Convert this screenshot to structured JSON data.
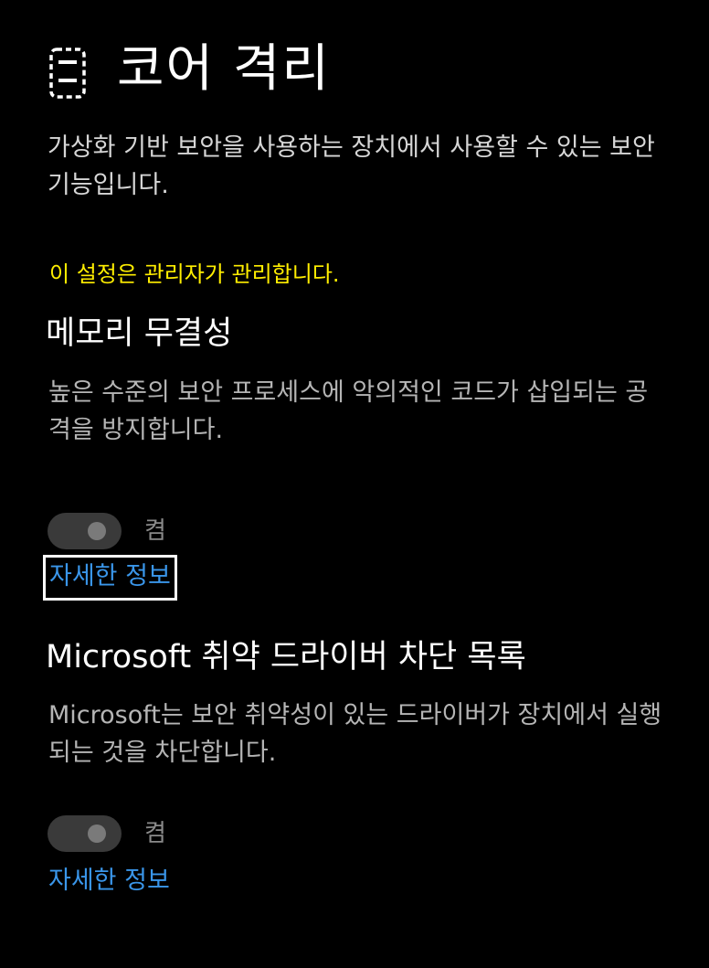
{
  "header": {
    "icon": "core-isolation-chip-icon",
    "title": "코어 격리",
    "description": "가상화 기반 보안을 사용하는 장치에서 사용할 수 있는 보안 기능입니다."
  },
  "managed_notice": "이 설정은 관리자가 관리합니다.",
  "memory_integrity": {
    "title": "메모리 무결성",
    "description": "높은 수준의 보안 프로세스에 악의적인 코드가 삽입되는 공격을 방지합니다.",
    "toggle_state": "켬",
    "toggle_on": true,
    "toggle_enabled": false,
    "learn_more": "자세한 정보"
  },
  "driver_blocklist": {
    "title": "Microsoft 취약 드라이버 차단 목록",
    "description": "Microsoft는 보안 취약성이 있는 드라이버가 장치에서 실행되는 것을 차단합니다.",
    "toggle_state": "켬",
    "toggle_on": true,
    "toggle_enabled": false,
    "learn_more": "자세한 정보"
  },
  "colors": {
    "background": "#000000",
    "title_text": "#ffffff",
    "body_text": "#b5b5b5",
    "managed_notice": "#ffee00",
    "link": "#3a96ea",
    "toggle_track_disabled": "#3a3a3a",
    "toggle_knob_disabled": "#7a7a7a"
  }
}
